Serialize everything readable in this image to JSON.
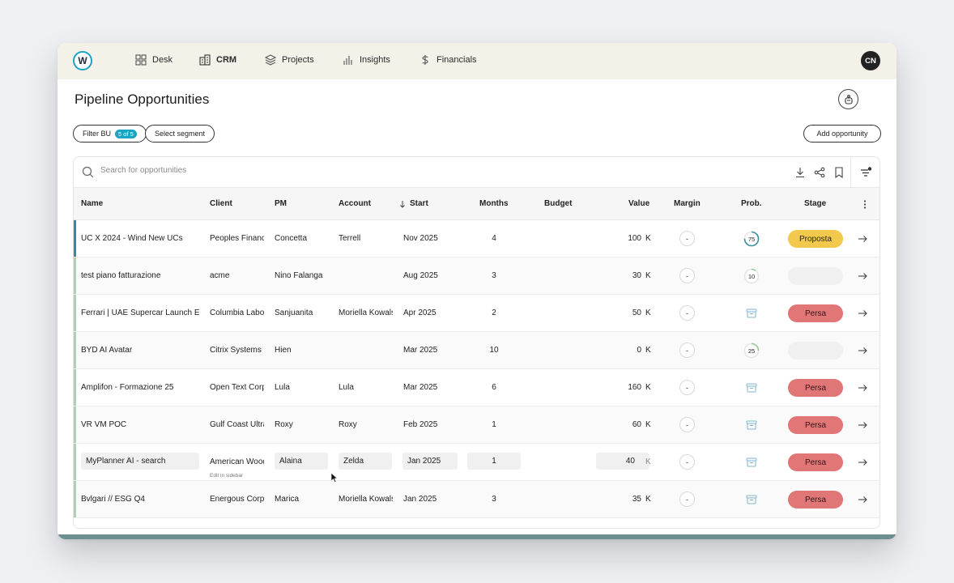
{
  "nav": {
    "logo": "W",
    "items": [
      {
        "label": "Desk",
        "icon": "grid-icon"
      },
      {
        "label": "CRM",
        "icon": "building-icon"
      },
      {
        "label": "Projects",
        "icon": "layers-icon"
      },
      {
        "label": "Insights",
        "icon": "bar-chart-icon"
      },
      {
        "label": "Financials",
        "icon": "dollar-icon"
      }
    ],
    "avatar": "CN"
  },
  "page": {
    "title": "Pipeline Opportunities"
  },
  "filters": {
    "filter_bu": "Filter BU",
    "filter_bu_badge": "5 of 5",
    "segment": "Select segment",
    "add": "Add opportunity"
  },
  "search": {
    "placeholder": "Search for opportunities"
  },
  "columns": {
    "name": "Name",
    "client": "Client",
    "pm": "PM",
    "account": "Account",
    "start": "Start",
    "months": "Months",
    "budget": "Budget",
    "value": "Value",
    "margin": "Margin",
    "prob": "Prob.",
    "stage": "Stage"
  },
  "unit": "K",
  "edit_hint": "Edit in sidebar",
  "rows": [
    {
      "name": "UC X 2024 - Wind New UCs",
      "client": "Peoples Financial",
      "pm": "Concetta",
      "account": "Terrell",
      "start": "Nov 2025",
      "months": "4",
      "value": "100",
      "margin": "-",
      "prob": 75,
      "prob_label": "75",
      "stage": "Proposta",
      "stage_color": "#f2c94c"
    },
    {
      "name": "test piano fatturazione",
      "client": "acme",
      "pm": "Nino Falanga",
      "account": "",
      "start": "Aug 2025",
      "months": "3",
      "value": "30",
      "margin": "-",
      "prob": 10,
      "prob_label": "10",
      "stage": "",
      "stage_color": "#f0f0f0"
    },
    {
      "name": "Ferrari | UAE Supercar Launch Event",
      "client": "Columbia Laboratories",
      "pm": "Sanjuanita",
      "account": "Moriella Kowalski",
      "start": "Apr 2025",
      "months": "2",
      "value": "50",
      "margin": "-",
      "prob": null,
      "prob_label": "",
      "stage": "Persa",
      "stage_color": "#e07676"
    },
    {
      "name": "BYD AI Avatar",
      "client": "Citrix Systems",
      "pm": "Hien",
      "account": "",
      "start": "Mar 2025",
      "months": "10",
      "value": "0",
      "margin": "-",
      "prob": 25,
      "prob_label": "25",
      "stage": "",
      "stage_color": "#f0f0f0"
    },
    {
      "name": "Amplifon - Formazione 25",
      "client": "Open Text Corp",
      "pm": "Lula",
      "account": "Lula",
      "start": "Mar 2025",
      "months": "6",
      "value": "160",
      "margin": "-",
      "prob": null,
      "prob_label": "",
      "stage": "Persa",
      "stage_color": "#e07676"
    },
    {
      "name": "VR VM POC",
      "client": "Gulf Coast Ultra",
      "pm": "Roxy",
      "account": "Roxy",
      "start": "Feb 2025",
      "months": "1",
      "value": "60",
      "margin": "-",
      "prob": null,
      "prob_label": "",
      "stage": "Persa",
      "stage_color": "#e07676"
    },
    {
      "name": "MyPlanner AI - search",
      "client": "American Woodmark",
      "pm": "Alaina",
      "account": "Zelda",
      "start": "Jan 2025",
      "months": "1",
      "value": "40",
      "margin": "-",
      "prob": null,
      "prob_label": "",
      "stage": "Persa",
      "stage_color": "#e07676"
    },
    {
      "name": "Bvlgari // ESG Q4",
      "client": "Energous Corp",
      "pm": "Marica",
      "account": "Moriella Kowalski",
      "start": "Jan 2025",
      "months": "3",
      "value": "35",
      "margin": "-",
      "prob": null,
      "prob_label": "",
      "stage": "Persa",
      "stage_color": "#e07676"
    }
  ],
  "colors": {
    "accent": "#1aa3c3",
    "persa": "#e07676",
    "proposta": "#f2c94c"
  }
}
